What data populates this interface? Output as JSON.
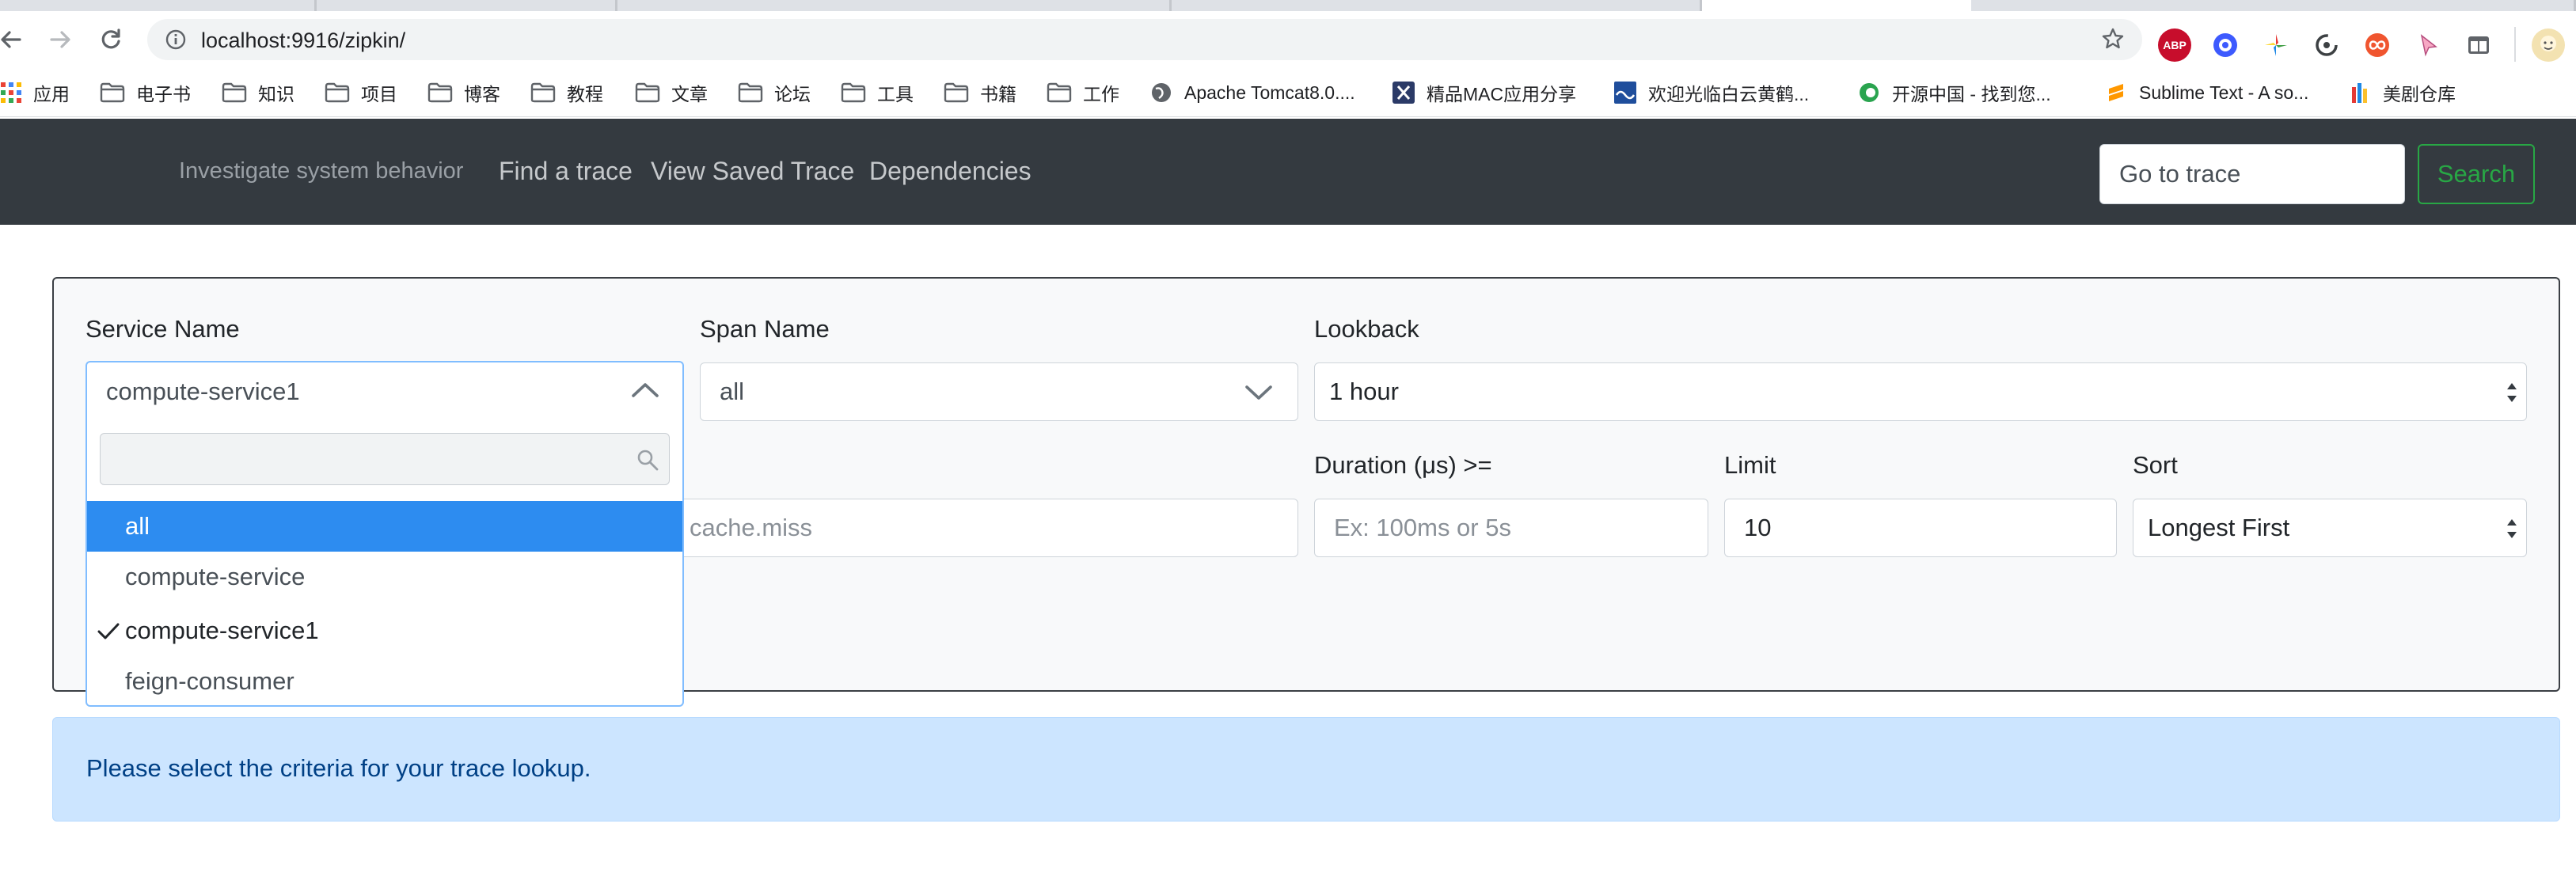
{
  "browser": {
    "url": "localhost:9916/zipkin/",
    "bookmarks": [
      {
        "label": "应用",
        "icon": "apps-grid-icon"
      },
      {
        "label": "电子书",
        "icon": "folder-icon"
      },
      {
        "label": "知识",
        "icon": "folder-icon"
      },
      {
        "label": "项目",
        "icon": "folder-icon"
      },
      {
        "label": "博客",
        "icon": "folder-icon"
      },
      {
        "label": "教程",
        "icon": "folder-icon"
      },
      {
        "label": "文章",
        "icon": "folder-icon"
      },
      {
        "label": "论坛",
        "icon": "folder-icon"
      },
      {
        "label": "工具",
        "icon": "folder-icon"
      },
      {
        "label": "书籍",
        "icon": "folder-icon"
      },
      {
        "label": "工作",
        "icon": "folder-icon"
      },
      {
        "label": "Apache Tomcat8.0....",
        "icon": "globe-icon"
      },
      {
        "label": "精品MAC应用分享",
        "icon": "x-logo-icon"
      },
      {
        "label": "欢迎光临白云黄鹤...",
        "icon": "wave-logo-icon"
      },
      {
        "label": "开源中国 - 找到您...",
        "icon": "oschina-logo-icon"
      },
      {
        "label": "Sublime Text - A so...",
        "icon": "sublime-logo-icon"
      },
      {
        "label": "美剧仓库",
        "icon": "tower-logo-icon"
      }
    ],
    "extensions": [
      {
        "name": "adblock-plus-icon",
        "text": "ABP",
        "color": "#c70d2c"
      },
      {
        "name": "rocket-extension-icon",
        "text": "",
        "color": "#3d5afe"
      },
      {
        "name": "pinwheel-extension-icon",
        "text": "",
        "color": "#ffffff"
      },
      {
        "name": "sync-extension-icon",
        "text": "",
        "color": "#ffffff"
      },
      {
        "name": "infinity-extension-icon",
        "text": "",
        "color": "#f0552f"
      },
      {
        "name": "cursor-extension-icon",
        "text": "",
        "color": "#ffffff"
      },
      {
        "name": "window-extension-icon",
        "text": "",
        "color": "#ffffff"
      }
    ]
  },
  "navbar": {
    "tagline": "Investigate system behavior",
    "links": [
      "Find a trace",
      "View Saved Trace",
      "Dependencies"
    ],
    "goto_placeholder": "Go to trace",
    "search_label": "Search"
  },
  "form": {
    "service_name": {
      "label": "Service Name",
      "value": "compute-service1"
    },
    "span_name": {
      "label": "Span Name",
      "value": "all"
    },
    "lookback": {
      "label": "Lookback",
      "value": "1 hour"
    },
    "annotations": {
      "placeholder": "cache.miss"
    },
    "duration": {
      "label": "Duration (μs) >=",
      "placeholder": "Ex: 100ms or 5s"
    },
    "limit": {
      "label": "Limit",
      "value": "10"
    },
    "sort": {
      "label": "Sort",
      "value": "Longest First"
    }
  },
  "dropdown": {
    "search_value": "",
    "options": [
      {
        "label": "all",
        "highlighted": true,
        "checked": false
      },
      {
        "label": "compute-service",
        "highlighted": false,
        "checked": false
      },
      {
        "label": "compute-service1",
        "highlighted": false,
        "checked": true
      },
      {
        "label": "feign-consumer",
        "highlighted": false,
        "checked": false
      }
    ]
  },
  "alert": {
    "message": "Please select the criteria for your trace lookup."
  },
  "colors": {
    "navbar_bg": "#343a40",
    "search_green": "#28a745",
    "option_highlight": "#2d8cf0",
    "alert_bg": "#cce5ff",
    "alert_text": "#004085"
  }
}
